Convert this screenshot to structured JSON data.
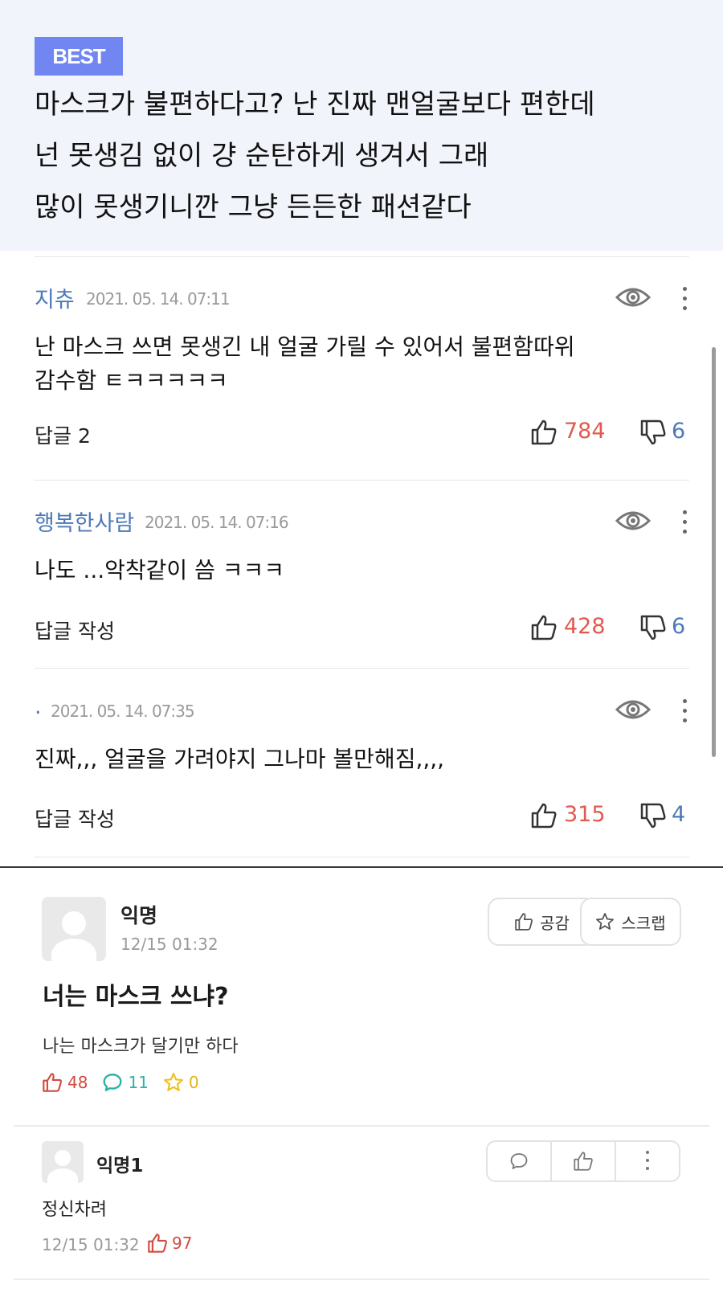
{
  "best": {
    "badge": "BEST",
    "lines": [
      "마스크가 불편하다고? 난 진짜 맨얼굴보다 편한데",
      "넌 못생김 없이 걍 순탄하게 생겨서 그래",
      "많이 못생기니깐 그냥 든든한 패션같다"
    ]
  },
  "comments": [
    {
      "author": "지츄",
      "date": "2021. 05. 14. 07:11",
      "body_lines": [
        "난 마스크 쓰면 못생긴 내 얼굴 가릴 수 있어서 불편함따위",
        "감수함 ㅌㅋㅋㅋㅋㅋ"
      ],
      "reply": "답글 2",
      "up": "784",
      "down": "6"
    },
    {
      "author": "행복한사람",
      "date": "2021. 05. 14. 07:16",
      "body_lines": [
        "나도 ...악착같이 씀 ㅋㅋㅋ"
      ],
      "reply": "답글 작성",
      "up": "428",
      "down": "6"
    },
    {
      "author": ".",
      "date": "2021. 05. 14. 07:35",
      "body_lines": [
        "진짜,,, 얼굴을 가려야지 그나마 볼만해짐,,,,"
      ],
      "reply": "답글 작성",
      "up": "315",
      "down": "4"
    }
  ],
  "post": {
    "author": "익명",
    "date": "12/15 01:32",
    "empathy_label": "공감",
    "scrap_label": "스크랩",
    "title": "너는 마스크 쓰냐?",
    "body": "나는 마스크가 달기만 하다",
    "likes": "48",
    "comments": "11",
    "scraps": "0"
  },
  "reply": {
    "author": "익명1",
    "body": "정신차려",
    "date": "12/15 01:32",
    "likes": "97"
  },
  "colors": {
    "accent": "#7186f0",
    "author": "#4d79b8",
    "like": "#e05a50",
    "comment": "#2bb3a8",
    "scrap": "#f0c020"
  }
}
